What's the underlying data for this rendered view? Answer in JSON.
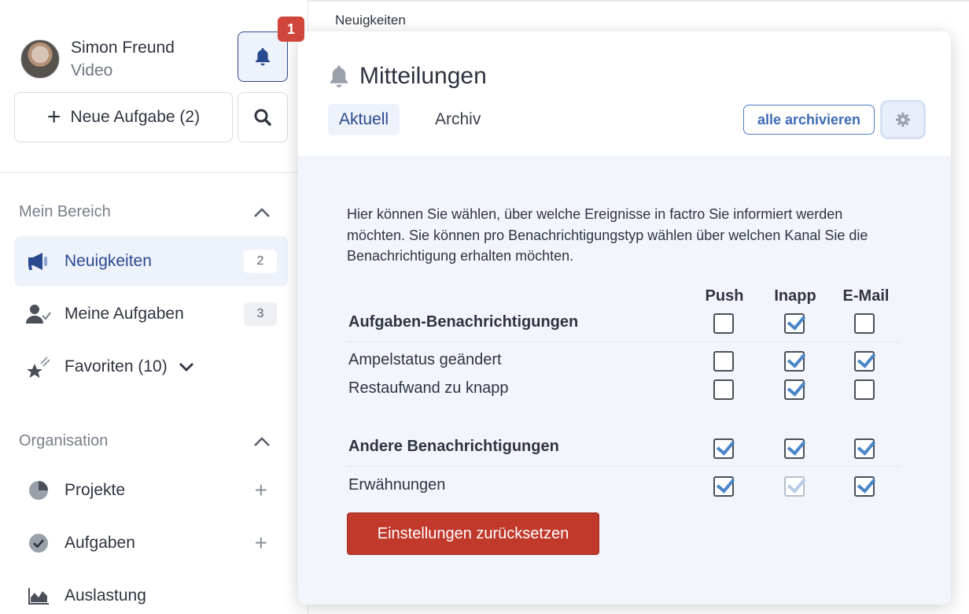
{
  "user": {
    "name": "Simon Freund",
    "subtitle": "Video"
  },
  "notifications": {
    "badge_count": "1"
  },
  "sidebar": {
    "new_task_label": "Neue Aufgabe (2)",
    "section_my": {
      "title": "Mein Bereich"
    },
    "my_items": [
      {
        "label": "Neuigkeiten",
        "count": "2",
        "icon": "megaphone-icon"
      },
      {
        "label": "Meine Aufgaben",
        "count": "3",
        "icon": "user-check-icon"
      },
      {
        "label": "Favoriten (10)",
        "icon": "star-icon"
      }
    ],
    "section_org": {
      "title": "Organisation"
    },
    "org_items": [
      {
        "label": "Projekte",
        "icon": "pie-chart-icon"
      },
      {
        "label": "Aufgaben",
        "icon": "check-circle-icon"
      },
      {
        "label": "Auslastung",
        "icon": "area-chart-icon"
      }
    ]
  },
  "topbar": {
    "title": "Neuigkeiten"
  },
  "popup": {
    "title": "Mitteilungen",
    "tabs": [
      "Aktuell",
      "Archiv"
    ],
    "archive_all_label": "alle archivieren",
    "description": "Hier können Sie wählen, über welche Ereignisse in factro Sie informiert werden möchten. Sie können pro Benachrichtigungstyp wählen über welchen Kanal Sie die Benachrichtigung erhalten möchten.",
    "columns": [
      "Push",
      "Inapp",
      "E-Mail"
    ],
    "groups": [
      {
        "title": "Aufgaben-Benachrichtigungen",
        "checks": [
          false,
          true,
          false
        ],
        "rows": [
          {
            "label": "Ampelstatus geändert",
            "checks": [
              false,
              true,
              true
            ]
          },
          {
            "label": "Restaufwand zu knapp",
            "checks": [
              false,
              true,
              false
            ]
          }
        ]
      },
      {
        "title": "Andere Benachrichtigungen",
        "checks": [
          true,
          true,
          true
        ],
        "rows": [
          {
            "label": "Erwähnungen",
            "checks": [
              true,
              true,
              true
            ],
            "disabled": [
              false,
              true,
              false
            ]
          }
        ]
      }
    ],
    "reset_label": "Einstellungen zurücksetzen"
  },
  "colors": {
    "accent": "#2a4a8f",
    "danger": "#c0392b",
    "badge": "#d0463b",
    "check": "#4a86c8"
  }
}
